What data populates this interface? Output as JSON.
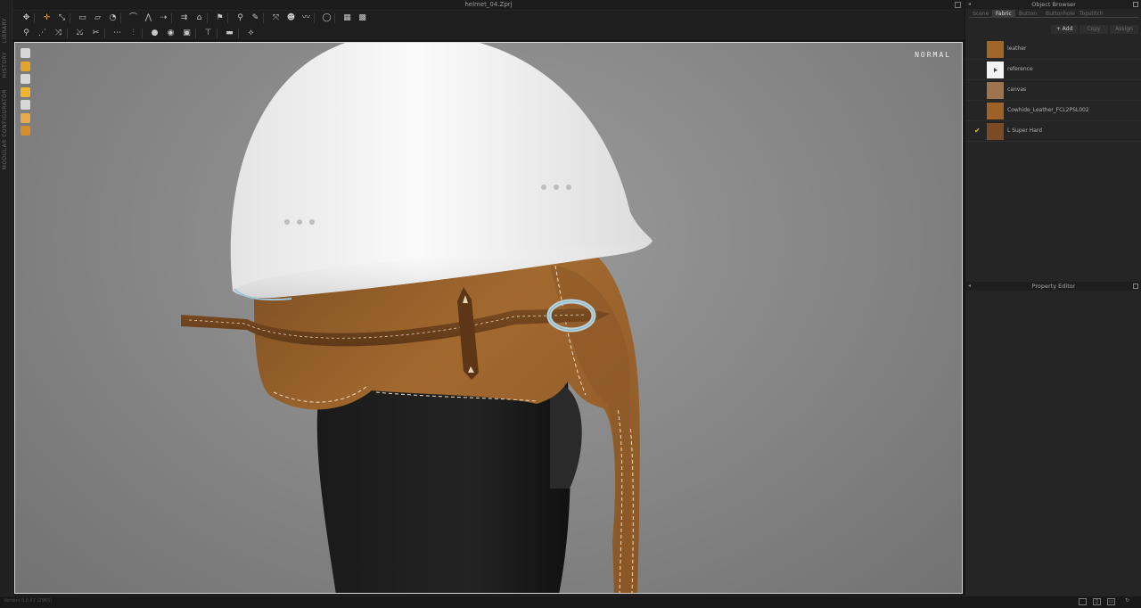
{
  "window": {
    "title": "helmet_04.Zprj"
  },
  "left_strip": {
    "tabs": [
      "LIBRARY",
      "HISTORY",
      "MODULAR CONFIGURATOR"
    ]
  },
  "toolbar_row1": [
    {
      "name": "select-move-icon",
      "glyph": "✥"
    },
    {
      "name": "transform-pattern-icon",
      "glyph": "✛",
      "accent": true
    },
    {
      "name": "edit-point-icon",
      "glyph": "⤡"
    },
    {
      "name": "create-rectangle-icon",
      "glyph": "▭"
    },
    {
      "name": "create-polygon-icon",
      "glyph": "▱"
    },
    {
      "name": "create-circle-icon",
      "glyph": "◔"
    },
    {
      "name": "edit-curvature-icon",
      "glyph": "⌒"
    },
    {
      "name": "create-dart-icon",
      "glyph": "⋀"
    },
    {
      "name": "segment-sewing-icon",
      "glyph": "⇢"
    },
    {
      "name": "free-sewing-icon",
      "glyph": "⇉"
    },
    {
      "name": "fold-arrangement-icon",
      "glyph": "⌂"
    },
    {
      "name": "tack-icon",
      "glyph": "⚑"
    },
    {
      "name": "pin-icon",
      "glyph": "⚲"
    },
    {
      "name": "trace-icon",
      "glyph": "✎"
    },
    {
      "name": "unfold-icon",
      "glyph": "⤧"
    },
    {
      "name": "fit-avatar-icon",
      "glyph": "☻"
    },
    {
      "name": "tape-icon",
      "glyph": "〰"
    },
    {
      "name": "ring-icon",
      "glyph": "◯"
    },
    {
      "name": "grid-icon",
      "glyph": "▦"
    },
    {
      "name": "pattern-grid-icon",
      "glyph": "▩"
    }
  ],
  "toolbar_row2": [
    {
      "name": "avatar-measure-icon",
      "glyph": "⚲"
    },
    {
      "name": "puckering-icon",
      "glyph": "⋰"
    },
    {
      "name": "shirring-icon",
      "glyph": "⤨"
    },
    {
      "name": "strengthen-icon",
      "glyph": "⤩"
    },
    {
      "name": "graphic-icon",
      "glyph": "✂"
    },
    {
      "name": "texture-icon",
      "glyph": "⋯"
    },
    {
      "name": "zipper-icon",
      "glyph": "⫶"
    },
    {
      "name": "button-icon",
      "glyph": "●"
    },
    {
      "name": "buttonhole-icon",
      "glyph": "◉"
    },
    {
      "name": "topstitch-icon",
      "glyph": "▣"
    },
    {
      "name": "measure-icon",
      "glyph": "⊤"
    },
    {
      "name": "ruler-icon",
      "glyph": "▬"
    },
    {
      "name": "gizmo-icon",
      "glyph": "⟡"
    }
  ],
  "viewport": {
    "mode": "NORMAL"
  },
  "viewport_tools": [
    {
      "name": "garment-display-icon",
      "color": "#d7d7d7"
    },
    {
      "name": "pattern-display-icon",
      "color": "#e2a52b"
    },
    {
      "name": "avatar-display-icon",
      "color": "#d7d7d7"
    },
    {
      "name": "fabric-display-icon",
      "color": "#f0b52e"
    },
    {
      "name": "cloth-mode-icon",
      "color": "#d7d7d7"
    },
    {
      "name": "avatar-skin-icon",
      "color": "#e8a84e"
    },
    {
      "name": "render-sphere-icon",
      "color": "#d48e2c"
    }
  ],
  "object_browser": {
    "title": "Object Browser",
    "tabs": [
      "Scene",
      "Fabric",
      "Button",
      "Buttonhole",
      "Topstitch"
    ],
    "active_tab": "Fabric",
    "actions": {
      "add": "+ Add",
      "copy": "Copy",
      "assign": "Assign"
    },
    "fabrics": [
      {
        "name": "leather",
        "color": "#a2652a",
        "checked": false
      },
      {
        "name": "reference",
        "color": "#f4f4f4",
        "checked": false
      },
      {
        "name": "canvas",
        "color": "#a0734f",
        "checked": false
      },
      {
        "name": "Cowhide_Leather_FCL2PSL002",
        "color": "#9e6229",
        "checked": false
      },
      {
        "name": "L Super Hard",
        "color": "#7a4b24",
        "checked": true
      }
    ]
  },
  "property_editor": {
    "title": "Property Editor"
  },
  "status": {
    "version": "Version 5.0.67 (2965)"
  }
}
